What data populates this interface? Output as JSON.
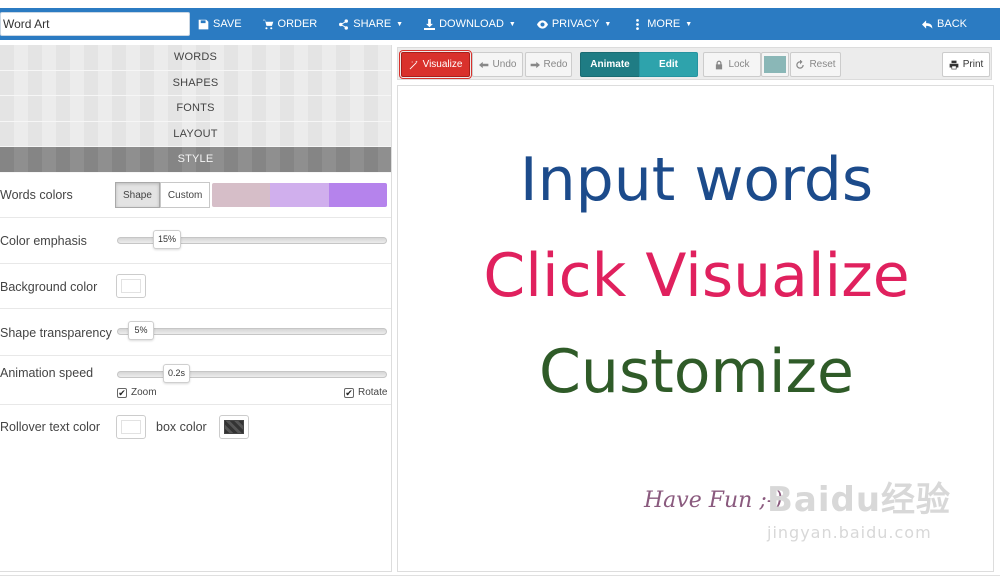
{
  "topbar": {
    "title_value": "Word Art",
    "save": "SAVE",
    "order": "ORDER",
    "share": "SHARE",
    "download": "DOWNLOAD",
    "privacy": "PRIVACY",
    "more": "MORE",
    "back": "BACK",
    "colors": {
      "bar": "#2b7bc2"
    }
  },
  "sidebar": {
    "sections": [
      "WORDS",
      "SHAPES",
      "FONTS",
      "LAYOUT",
      "STYLE"
    ],
    "active_section": "STYLE",
    "style": {
      "words_colors_label": "Words colors",
      "shape_button": "Shape",
      "custom_button": "Custom",
      "swatch_colors": [
        "#d6bec8",
        "#d0afed",
        "#b583ec"
      ],
      "color_emphasis_label": "Color emphasis",
      "color_emphasis_value": "15%",
      "background_color_label": "Background color",
      "shape_transparency_label": "Shape transparency",
      "shape_transparency_value": "5%",
      "animation_speed_label": "Animation speed",
      "animation_speed_value": "0.2s",
      "zoom_label": "Zoom",
      "rotate_label": "Rotate",
      "rollover_text_color_label": "Rollover text color",
      "box_color_label": "box color"
    }
  },
  "toolbar": {
    "visualize": "Visualize",
    "undo": "Undo",
    "redo": "Redo",
    "animate": "Animate",
    "edit": "Edit",
    "lock": "Lock",
    "reset": "Reset",
    "print": "Print",
    "colors": {
      "visualize": "#d9312c",
      "animate": "#1f7c84",
      "edit": "#2ea3ac",
      "swatch": "#8ab7b7"
    }
  },
  "canvas": {
    "line1": "Input words",
    "line2": "Click Visualize",
    "line3": "Customize",
    "fun": "Have Fun ;-)",
    "watermark_logo": "Baidu经验",
    "watermark_sub": "jingyan.baidu.com",
    "colors": {
      "line1": "#1c4b8b",
      "line2": "#e0215e",
      "line3": "#2f5b28"
    }
  }
}
